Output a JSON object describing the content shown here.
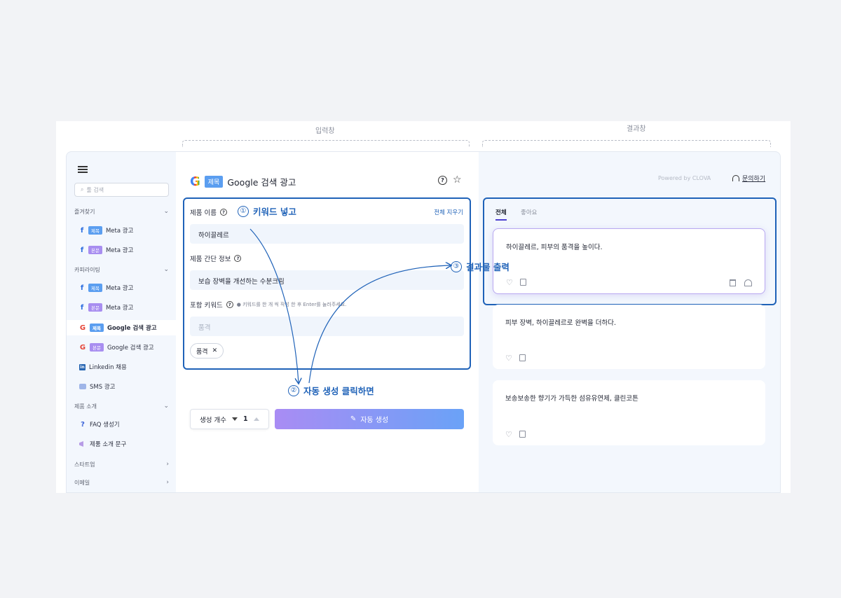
{
  "top_labels": {
    "input": "입력창",
    "result": "결과창"
  },
  "sidebar": {
    "search_placeholder": "툴 검색",
    "sections": [
      {
        "label": "즐겨찾기"
      },
      {
        "label": "카피라이팅"
      },
      {
        "label": "제품 소개"
      },
      {
        "label": "스타트업"
      },
      {
        "label": "이메일"
      }
    ],
    "items": [
      {
        "badge": "제목",
        "label": "Meta 광고"
      },
      {
        "badge": "본문",
        "label": "Meta 광고"
      },
      {
        "badge": "제목",
        "label": "Meta 광고"
      },
      {
        "badge": "본문",
        "label": "Meta 광고"
      },
      {
        "badge": "제목",
        "label": "Google 검색 광고"
      },
      {
        "badge": "본문",
        "label": "Google 검색 광고"
      },
      {
        "label": "Linkedin 채용"
      },
      {
        "label": "SMS 광고"
      },
      {
        "label": "FAQ 생성기"
      },
      {
        "label": "제품 소개 문구"
      }
    ]
  },
  "input_panel": {
    "title_badge": "제목",
    "title": "Google 검색 광고",
    "product_name_label": "제품 이름",
    "clear_all": "전체 지우기",
    "product_name_value": "하이끌레르",
    "product_info_label": "제품 간단 정보",
    "product_info_value": "보습 장벽을 개선하는 수분크림",
    "keywords_label": "포함 키워드",
    "keywords_hint": "● 키워드를 한 개 씩 작성 한 후 Enter를 눌러주세요.",
    "keywords_placeholder": "품격",
    "chip_label": "품격",
    "count_label": "생성 개수",
    "count_value": "1",
    "generate_label": "자동 생성"
  },
  "annotations": {
    "step1": {
      "num": "①",
      "text": "키워드 넣고"
    },
    "step2": {
      "num": "②",
      "text": "자동 생성 클릭하면"
    },
    "step3": {
      "num": "③",
      "text": "결과물 출력"
    }
  },
  "result_panel": {
    "powered": "Powered by CLOVA",
    "inquiry": "문의하기",
    "tabs": {
      "all": "전체",
      "liked": "좋아요"
    },
    "results": [
      "하이끌레르, 피부의 품격을 높이다.",
      "피부 장벽, 하이끌레르로 완벽을 더하다.",
      "보송보송한 향기가 가득한 섬유유연제, 클린코튼"
    ]
  },
  "colors": {
    "accent": "#1f62b8",
    "button_start": "#a98cf4",
    "button_end": "#6aa2f7"
  }
}
